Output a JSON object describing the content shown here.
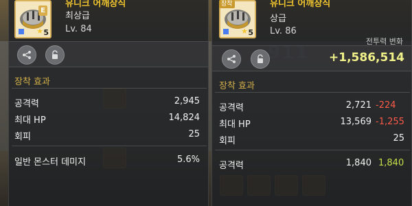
{
  "left_tooltip": {
    "item_name": "유니크 어깨장식",
    "grade_letter": "E",
    "star_count": "5",
    "grade": "최상급",
    "level": "Lv. 84",
    "section_title": "장착 효과",
    "stats": [
      {
        "label": "공격력",
        "value": "2,945"
      },
      {
        "label": "최대 HP",
        "value": "14,824"
      },
      {
        "label": "회피",
        "value": "25"
      },
      {
        "label": "일반 몬스터 데미지",
        "value": "5.6%"
      }
    ]
  },
  "right_tooltip": {
    "badge": "장착",
    "item_name": "유니크 어깨장식",
    "star_count": "5",
    "grade": "상급",
    "level": "Lv. 86",
    "cp_label": "전투력 변화",
    "cp_value": "+1,586,514",
    "section_title": "장착 효과",
    "stats": [
      {
        "label": "공격력",
        "value": "2,721",
        "diff": "-224",
        "diff_type": "negative"
      },
      {
        "label": "최대 HP",
        "value": "13,569",
        "diff": "-1,255",
        "diff_type": "negative"
      },
      {
        "label": "회피",
        "value": "25",
        "diff": "",
        "diff_type": "none"
      },
      {
        "label": "공격력",
        "value": "1,840",
        "diff": "1,840",
        "diff_type": "positive"
      }
    ]
  },
  "icons": {
    "share": "share-icon",
    "lock": "lock-icon",
    "item": "shoulder-armor-icon"
  },
  "colors": {
    "item_name": "#f1c52d",
    "section_title": "#d6b24a",
    "cp_value": "#f1f18a",
    "negative": "#ff5a4a",
    "positive": "#c7e04a"
  }
}
